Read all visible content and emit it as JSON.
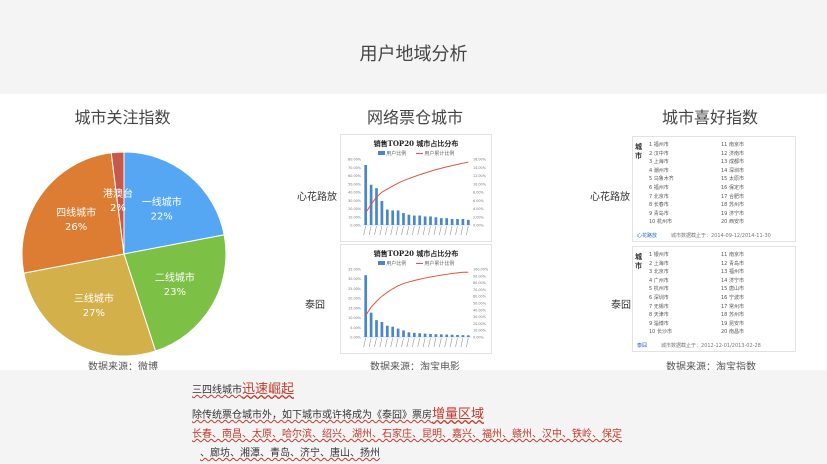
{
  "page": {
    "title": "用户地域分析"
  },
  "city_attention": {
    "title": "城市关注指数",
    "source": "数据来源：微博",
    "chart_data": {
      "type": "pie",
      "slices": [
        {
          "label": "一线城市",
          "value": 22,
          "display": "22%",
          "color": "#55a7f3"
        },
        {
          "label": "二线城市",
          "value": 23,
          "display": "23%",
          "color": "#7cc046"
        },
        {
          "label": "三线城市",
          "value": 27,
          "display": "27%",
          "color": "#d4b04a"
        },
        {
          "label": "四线城市",
          "value": 26,
          "display": "26%",
          "color": "#dd7d33"
        },
        {
          "label": "港澳台",
          "value": 2,
          "display": "2%",
          "color": "#c8584a"
        }
      ]
    }
  },
  "box_office": {
    "title": "网络票仓城市",
    "source": "数据来源：淘宝电影",
    "items": [
      {
        "label": "心花路放",
        "chart_data": {
          "type": "bar",
          "title": "销售TOP20 城市占比分布",
          "legend": [
            "用户比例",
            "用户累计比例"
          ],
          "y_ticks_left": [
            "80.00%",
            "70.00%",
            "60.00%",
            "50.00%",
            "40.00%",
            "30.00%",
            "20.00%",
            "10.00%",
            "0.00%"
          ],
          "y_ticks_right": [
            "16.00%",
            "14.00%",
            "12.00%",
            "10.00%",
            "8.00%",
            "6.00%",
            "4.00%",
            "2.00%",
            "0.00%"
          ],
          "values": [
            14,
            9.4,
            8.6,
            5.6,
            3.6,
            3.4,
            3.4,
            2.8,
            2.4,
            2.2,
            2.2,
            2.0,
            2.0,
            1.8,
            1.6,
            1.6,
            1.4,
            1.4,
            1.4,
            1.2
          ],
          "cumulative": [
            14,
            23.4,
            32,
            37.6,
            41.2,
            44.6,
            48,
            50.8,
            53.2,
            55.4,
            57.6,
            59.6,
            61.6,
            63.4,
            65,
            66.6,
            68,
            69.4,
            70.8,
            72
          ]
        }
      },
      {
        "label": "泰囧",
        "chart_data": {
          "type": "bar",
          "title": "销售TOP20 城市占比分布",
          "legend": [
            "用户比例",
            "用户累计比例"
          ],
          "y_ticks_left": [
            "35.00%",
            "30.00%",
            "25.00%",
            "20.00%",
            "15.00%",
            "10.00%",
            "5.00%",
            "0.00%"
          ],
          "y_ticks_right": [
            "100.00%",
            "90.00%",
            "80.00%",
            "70.00%",
            "60.00%",
            "50.00%",
            "40.00%",
            "30.00%",
            "20.00%",
            "10.00%",
            "0.00%"
          ],
          "values": [
            33,
            13,
            9,
            8,
            6,
            5.5,
            4.5,
            3.5,
            2.5,
            2.2,
            2.0,
            1.8,
            1.6,
            1.5,
            1.4,
            1.3,
            1.2,
            1.1,
            1.0,
            0.9
          ],
          "cumulative": [
            33,
            46,
            55,
            63,
            69,
            74.5,
            79,
            82.5,
            85,
            87.2,
            89.2,
            91,
            92.6,
            94.1,
            95.5,
            96.8,
            98,
            99.1,
            100,
            100
          ]
        }
      }
    ]
  },
  "city_preference": {
    "title": "城市喜好指数",
    "source": "数据来源：淘宝指数",
    "items": [
      {
        "label": "心花路放",
        "side": "城市",
        "col1": [
          "1 福州市",
          "2 汉中市",
          "3 上海市",
          "4 潮州市",
          "5 乌鲁木齐",
          "6 福州市",
          "7 北京市",
          "8 长春市",
          "9 青岛市",
          "10 杭州市"
        ],
        "col2": [
          "11 南京市",
          "12 济南市",
          "13 成都市",
          "14 深圳市",
          "15 太原市",
          "16 保定市",
          "17 合肥市",
          "18 苏州市",
          "19 济宁市",
          "20 西安市"
        ],
        "link": "心花路放",
        "footer": "城市数据截止于：2014-09-12/2014-11-30"
      },
      {
        "label": "泰囧",
        "side": "城市",
        "col1": [
          "1 银州市",
          "2 上海市",
          "3 北京市",
          "4 广州市",
          "5 杭州市",
          "6 深圳市",
          "7 无锡市",
          "8 天津市",
          "9 淄博市",
          "10 长沙市"
        ],
        "col2": [
          "11 南京市",
          "12 青岛市",
          "13 福州市",
          "14 济宁市",
          "15 唐山市",
          "16 宁波市",
          "17 常州市",
          "18 苏州市",
          "19 昆安市",
          "20 南昌市"
        ],
        "link": "泰囧",
        "footer": "城市数据截止于：2012-12-01/2013-02-28"
      }
    ]
  },
  "bullets": {
    "line1_prefix": "三四线城市",
    "line1_highlight": "迅速崛起",
    "line2_prefix": "除传统票仓城市外，如下城市或许将成为《泰囧》票房",
    "line2_highlight": "增量区域",
    "line3": "长春、南昌、太原、哈尔滨、绍兴、湖州、石家庄、昆明、嘉兴、福州、赣州、汉中、铁岭、保定",
    "line4": "、廊坊、湘潭、青岛、济宁、唐山、扬州"
  }
}
